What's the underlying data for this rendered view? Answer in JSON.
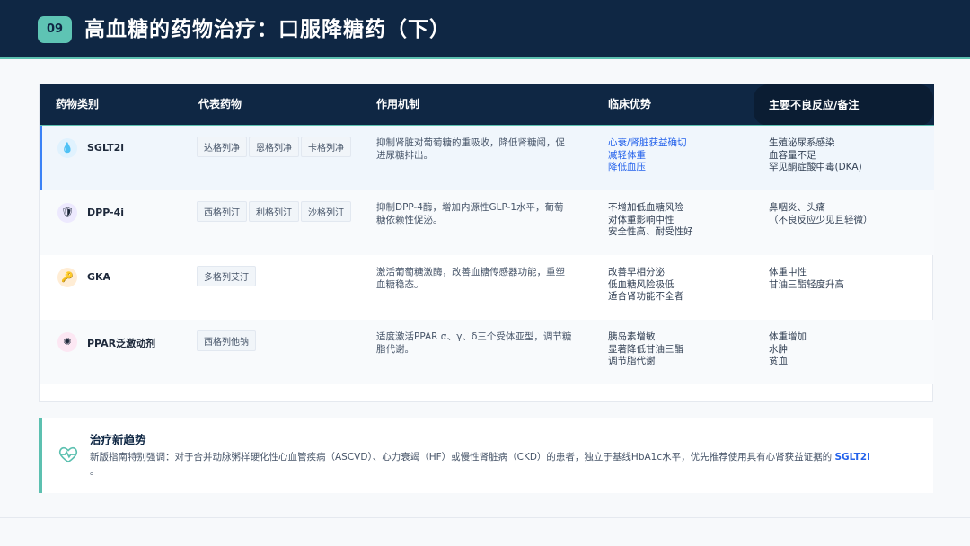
{
  "header": {
    "number": "09",
    "title": "高血糖的药物治疗：口服降糖药（下）"
  },
  "table": {
    "columns": [
      "药物类别",
      "代表药物",
      "作用机制",
      "临床优势",
      "主要不良反应/备注"
    ],
    "rows": [
      {
        "icon": "water-drop-icon",
        "icon_glyph": "💧",
        "icon_bg": "#e0f2fe",
        "name": "SGLT2i",
        "drugs": [
          "达格列净",
          "恩格列净",
          "卡格列净"
        ],
        "mechanism": [
          "抑制肾脏对葡萄糖的重吸收，降低肾糖阈，促",
          "进尿糖排出。"
        ],
        "advantages": [
          "心衰/肾脏获益确切",
          "减轻体重",
          "降低血压"
        ],
        "advantages_color": "#2563eb",
        "notes": [
          "生殖泌尿系感染",
          "血容量不足",
          "罕见酮症酸中毒(DKA)"
        ]
      },
      {
        "icon": "shield-icon",
        "icon_glyph": "🛡",
        "icon_bg": "#ede9fe",
        "name": "DPP-4i",
        "drugs": [
          "西格列汀",
          "利格列汀",
          "沙格列汀"
        ],
        "mechanism": [
          "抑制DPP-4酶，增加内源性GLP-1水平，葡萄",
          "糖依赖性促泌。"
        ],
        "advantages": [
          "不增加低血糖风险",
          "对体重影响中性",
          "安全性高、耐受性好"
        ],
        "advantages_color": "#334155",
        "notes": [
          "鼻咽炎、头痛",
          "（不良反应少见且轻微）"
        ]
      },
      {
        "icon": "key-icon",
        "icon_glyph": "🔑",
        "icon_bg": "#ffedd5",
        "name": "GKA",
        "drugs": [
          "多格列艾汀"
        ],
        "mechanism": [
          "激活葡萄糖激酶，改善血糖传感器功能，重塑",
          "血糖稳态。"
        ],
        "advantages": [
          "改善早相分泌",
          "低血糖风险极低",
          "适合肾功能不全者"
        ],
        "advantages_color": "#334155",
        "notes": [
          "体重中性",
          "甘油三酯轻度升高"
        ]
      },
      {
        "icon": "virus-icon",
        "icon_glyph": "✺",
        "icon_bg": "#fce7f3",
        "name": "PPAR泛激动剂",
        "drugs": [
          "西格列他钠"
        ],
        "mechanism": [
          "适度激活PPAR α、γ、δ三个受体亚型，调节糖",
          "脂代谢。"
        ],
        "advantages": [
          "胰岛素增敏",
          "显著降低甘油三酯",
          "调节脂代谢"
        ],
        "advantages_color": "#334155",
        "notes": [
          "体重增加",
          "水肿",
          "贫血"
        ]
      }
    ]
  },
  "trend": {
    "icon": "heart-pulse-icon",
    "title": "治疗新趋势",
    "text_before": "新版指南特别强调：对于合并动脉粥样硬化性心血管疾病（ASCVD）、心力衰竭（HF）或慢性肾脏病（CKD）的患者，独立于基线HbA1c水平，优先推荐使用具有心肾获益证据的",
    "highlight": "SGLT2i",
    "text_after": "。"
  },
  "colors": {
    "header_bg": "#0f2744",
    "accent_teal": "#5ec4b4",
    "accent_blue": "#2563eb"
  }
}
